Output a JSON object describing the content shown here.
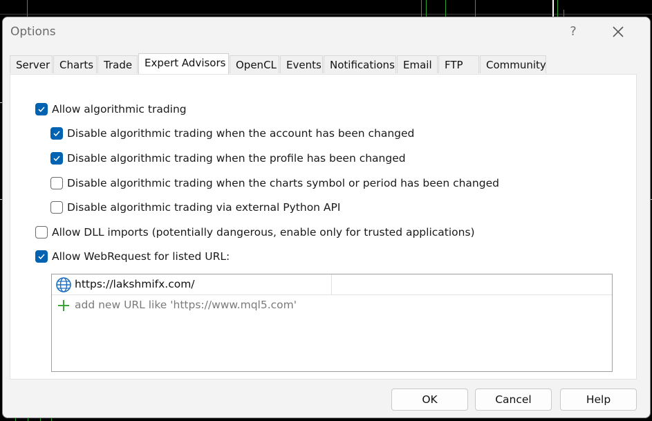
{
  "dialog": {
    "title": "Options",
    "help_glyph": "?",
    "close_icon": "close-icon"
  },
  "tabs": [
    {
      "label": "Server",
      "active": false
    },
    {
      "label": "Charts",
      "active": false
    },
    {
      "label": "Trade",
      "active": false
    },
    {
      "label": "Expert Advisors",
      "active": true
    },
    {
      "label": "OpenCL",
      "active": false
    },
    {
      "label": "Events",
      "active": false
    },
    {
      "label": "Notifications",
      "active": false
    },
    {
      "label": "Email",
      "active": false
    },
    {
      "label": "FTP",
      "active": false
    },
    {
      "label": "Community",
      "active": false
    }
  ],
  "options": [
    {
      "label": "Allow algorithmic trading",
      "checked": true
    },
    {
      "label": "Disable algorithmic trading when the account has been changed",
      "checked": true
    },
    {
      "label": "Disable algorithmic trading when the profile has been changed",
      "checked": true
    },
    {
      "label": "Disable algorithmic trading when the charts symbol or period has been changed",
      "checked": false
    },
    {
      "label": "Disable algorithmic trading via external Python API",
      "checked": false
    },
    {
      "label": "Allow DLL imports (potentially dangerous, enable only for trusted applications)",
      "checked": false
    },
    {
      "label": "Allow WebRequest for listed URL:",
      "checked": true
    }
  ],
  "url_list": {
    "entries": [
      "https://lakshmifx.com/"
    ],
    "entry_icon": "globe-icon",
    "add_placeholder": "add new URL like 'https://www.mql5.com'",
    "add_icon": "plus-icon"
  },
  "buttons": {
    "ok": "OK",
    "cancel": "Cancel",
    "help": "Help"
  },
  "colors": {
    "accent": "#0063b1",
    "add_icon": "#3aa63a",
    "globe_icon": "#1e6fbf"
  }
}
